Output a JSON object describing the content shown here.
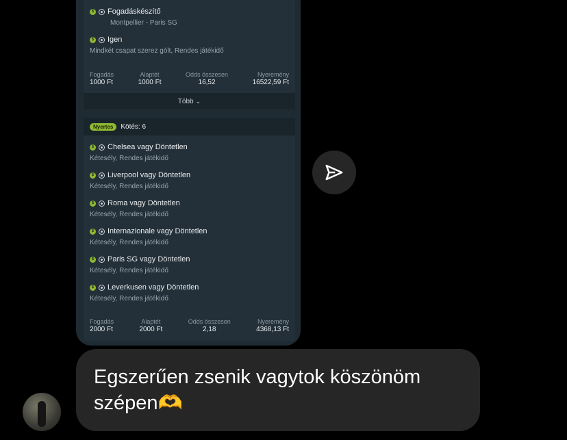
{
  "shared_bet_1": {
    "selections": [
      {
        "title": "Fogadáskészítő",
        "subtitle": "Montpellier - Paris SG"
      },
      {
        "title": "Igen",
        "subtitle": "Mindkét csapat szerez gólt, Rendes játékidő"
      }
    ],
    "summary": {
      "stake_label": "Fogadás",
      "stake": "1000 Ft",
      "base_label": "Alaptét",
      "base": "1000 Ft",
      "odds_label": "Odds összesen",
      "odds": "16,52",
      "win_label": "Nyeremény",
      "win": "16522,59 Ft"
    },
    "more_label": "Több"
  },
  "shared_bet_2": {
    "badge": "Nyertes",
    "header": "Kötés: 6",
    "selections": [
      {
        "title": "Chelsea vagy Döntetlen",
        "subtitle": "Kétesély, Rendes játékidő"
      },
      {
        "title": "Liverpool vagy Döntetlen",
        "subtitle": "Kétesély, Rendes játékidő"
      },
      {
        "title": "Roma vagy Döntetlen",
        "subtitle": "Kétesély, Rendes játékidő"
      },
      {
        "title": "Internazionale vagy Döntetlen",
        "subtitle": "Kétesély, Rendes játékidő"
      },
      {
        "title": "Paris SG vagy Döntetlen",
        "subtitle": "Kétesély, Rendes játékidő"
      },
      {
        "title": "Leverkusen vagy Döntetlen",
        "subtitle": "Kétesély, Rendes játékidő"
      }
    ],
    "summary": {
      "stake_label": "Fogadás",
      "stake": "2000 Ft",
      "base_label": "Alaptét",
      "base": "2000 Ft",
      "odds_label": "Odds összesen",
      "odds": "2,18",
      "win_label": "Nyeremény",
      "win": "4368,13 Ft"
    }
  },
  "message": {
    "text": "Egszerűen zsenik vagytok köszönöm szépen🫶"
  },
  "icons": {
    "send": "send-icon",
    "coin": "coin-icon",
    "ball": "soccer-ball-icon",
    "chevron": "chevron-down-icon"
  },
  "colors": {
    "accent": "#8fb832",
    "card": "#243039",
    "bubble": "#262626"
  }
}
